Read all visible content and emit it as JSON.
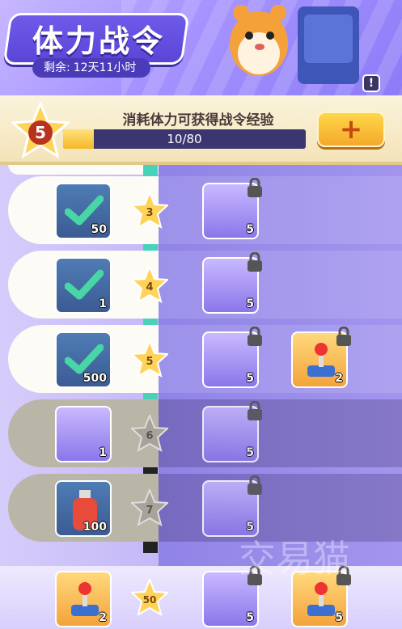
{
  "header": {
    "title": "体力战令",
    "timer_label": "剩余:",
    "timer_value": "12天11小时",
    "info_icon": "info-icon"
  },
  "xp": {
    "level": "5",
    "caption": "消耗体力可获得战令经验",
    "progress_text": "10/80",
    "progress_fraction": 0.125,
    "plus_label": "+"
  },
  "rows": [
    {
      "level": "3",
      "free_qty": "50",
      "paid_qty": "5"
    },
    {
      "level": "4",
      "free_qty": "1",
      "paid_qty": "5"
    },
    {
      "level": "5",
      "free_qty": "500",
      "paid_qty": "5",
      "paid2_qty": "2"
    },
    {
      "level": "6",
      "free_qty": "1",
      "paid_qty": "5"
    },
    {
      "level": "7",
      "free_qty": "100",
      "paid_qty": "5"
    }
  ],
  "bottom": {
    "level": "50",
    "free_qty": "2",
    "paid_qty": "5",
    "paid2_qty": "5"
  },
  "watermark": "交易猫"
}
